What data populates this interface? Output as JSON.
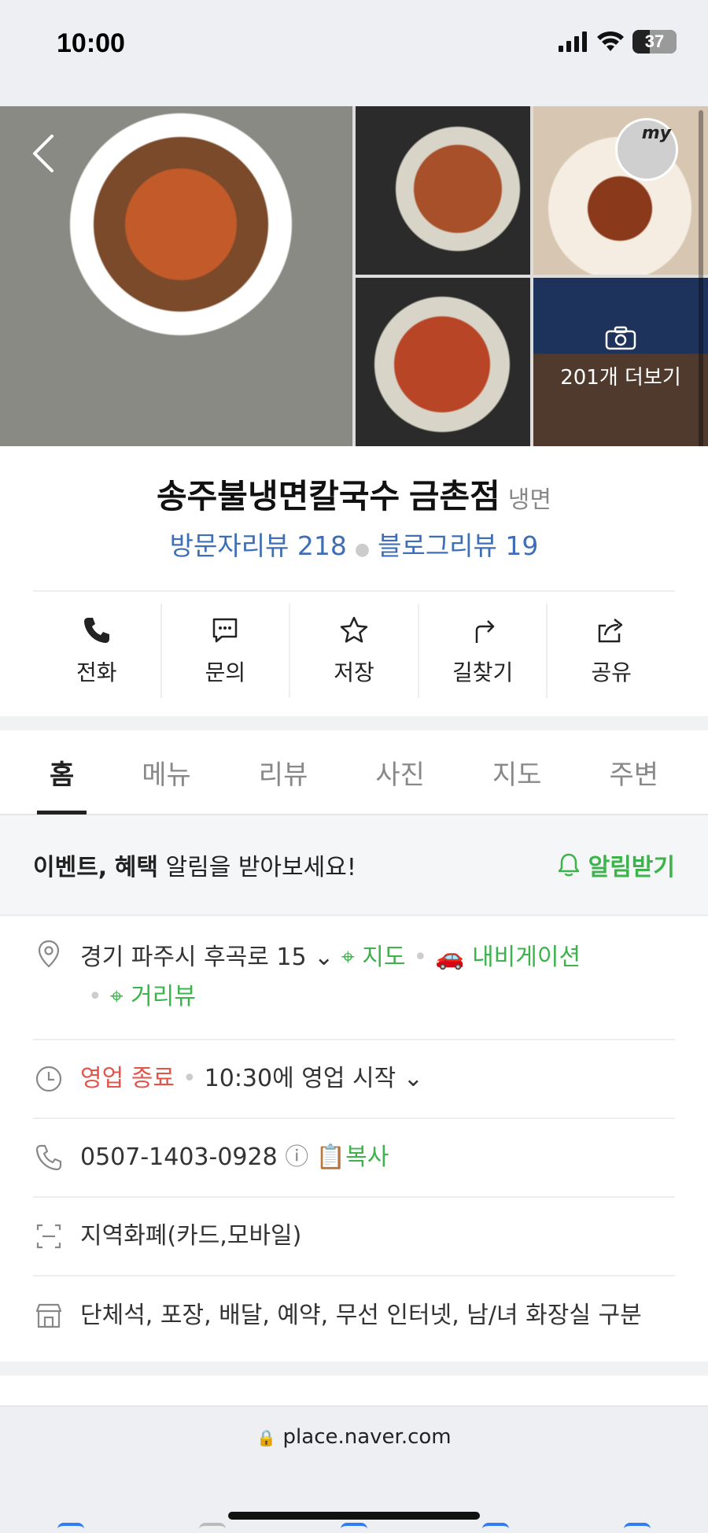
{
  "status_bar": {
    "time": "10:00",
    "battery": "37"
  },
  "photos": {
    "more_label": "201개 더보기",
    "badge": "my"
  },
  "place": {
    "name": "송주불냉면칼국수 금촌점",
    "category": "냉면",
    "visitor_reviews": "방문자리뷰 218",
    "blog_reviews": "블로그리뷰 19"
  },
  "actions": [
    {
      "label": "전화",
      "icon": "phone-icon"
    },
    {
      "label": "문의",
      "icon": "chat-icon"
    },
    {
      "label": "저장",
      "icon": "star-icon"
    },
    {
      "label": "길찾기",
      "icon": "directions-icon"
    },
    {
      "label": "공유",
      "icon": "share-icon"
    }
  ],
  "tabs": [
    "홈",
    "메뉴",
    "리뷰",
    "사진",
    "지도",
    "주변"
  ],
  "active_tab": "홈",
  "event": {
    "bold1": "이벤트,",
    "bold2": "혜택",
    "rest": "알림을 받아보세요!",
    "button": "알림받기"
  },
  "details": {
    "address": "경기 파주시 후곡로 15",
    "map": "지도",
    "navigation": "내비게이션",
    "street_view": "거리뷰",
    "status": "영업 종료",
    "hours": "10:30에 영업 시작",
    "phone": "0507-1403-0928",
    "copy": "복사",
    "payment": "지역화폐(카드,모바일)",
    "amenities": "단체석, 포장, 배달, 예약, 무선 인터넷, 남/녀 화장실 구분"
  },
  "browser": {
    "url": "place.naver.com"
  },
  "colors": {
    "green": "#3cb44b",
    "blue": "#3e6fb6",
    "red": "#e5534b"
  }
}
